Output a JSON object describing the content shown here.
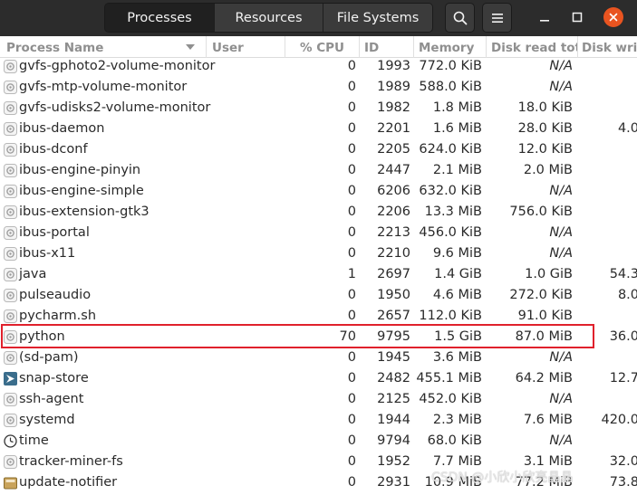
{
  "header": {
    "tabs": [
      {
        "label": "Processes",
        "active": true
      },
      {
        "label": "Resources",
        "active": false
      },
      {
        "label": "File Systems",
        "active": false
      }
    ],
    "search_icon": "search-icon",
    "menu_icon": "hamburger-menu-icon",
    "window_controls": [
      "minimize-icon",
      "maximize-icon",
      "close-icon"
    ],
    "close_color": "#e95420"
  },
  "columns": {
    "name": "Process Name",
    "user": "User",
    "cpu": "% CPU",
    "id": "ID",
    "memory": "Memory",
    "disk_read": "Disk read tota",
    "disk_write": "Disk writ"
  },
  "rows": [
    {
      "name": "gvfs-gphoto2-volume-monitor",
      "cpu": "0",
      "id": "1993",
      "memory": "772.0 KiB",
      "disk_read": "N/A",
      "disk_write": "",
      "icon": "gear-icon"
    },
    {
      "name": "gvfs-mtp-volume-monitor",
      "cpu": "0",
      "id": "1989",
      "memory": "588.0 KiB",
      "disk_read": "N/A",
      "disk_write": "",
      "icon": "gear-icon"
    },
    {
      "name": "gvfs-udisks2-volume-monitor",
      "cpu": "0",
      "id": "1982",
      "memory": "1.8 MiB",
      "disk_read": "18.0 KiB",
      "disk_write": "",
      "icon": "gear-icon"
    },
    {
      "name": "ibus-daemon",
      "cpu": "0",
      "id": "2201",
      "memory": "1.6 MiB",
      "disk_read": "28.0 KiB",
      "disk_write": "4.0",
      "icon": "gear-icon"
    },
    {
      "name": "ibus-dconf",
      "cpu": "0",
      "id": "2205",
      "memory": "624.0 KiB",
      "disk_read": "12.0 KiB",
      "disk_write": "",
      "icon": "gear-icon"
    },
    {
      "name": "ibus-engine-pinyin",
      "cpu": "0",
      "id": "2447",
      "memory": "2.1 MiB",
      "disk_read": "2.0 MiB",
      "disk_write": "",
      "icon": "gear-icon"
    },
    {
      "name": "ibus-engine-simple",
      "cpu": "0",
      "id": "6206",
      "memory": "632.0 KiB",
      "disk_read": "N/A",
      "disk_write": "",
      "icon": "gear-icon"
    },
    {
      "name": "ibus-extension-gtk3",
      "cpu": "0",
      "id": "2206",
      "memory": "13.3 MiB",
      "disk_read": "756.0 KiB",
      "disk_write": "",
      "icon": "gear-icon"
    },
    {
      "name": "ibus-portal",
      "cpu": "0",
      "id": "2213",
      "memory": "456.0 KiB",
      "disk_read": "N/A",
      "disk_write": "",
      "icon": "gear-icon"
    },
    {
      "name": "ibus-x11",
      "cpu": "0",
      "id": "2210",
      "memory": "9.6 MiB",
      "disk_read": "N/A",
      "disk_write": "",
      "icon": "gear-icon"
    },
    {
      "name": "java",
      "cpu": "1",
      "id": "2697",
      "memory": "1.4 GiB",
      "disk_read": "1.0 GiB",
      "disk_write": "54.3",
      "icon": "gear-icon"
    },
    {
      "name": "pulseaudio",
      "cpu": "0",
      "id": "1950",
      "memory": "4.6 MiB",
      "disk_read": "272.0 KiB",
      "disk_write": "8.0",
      "icon": "gear-icon"
    },
    {
      "name": "pycharm.sh",
      "cpu": "0",
      "id": "2657",
      "memory": "112.0 KiB",
      "disk_read": "91.0 KiB",
      "disk_write": "",
      "icon": "gear-icon"
    },
    {
      "name": "python",
      "cpu": "70",
      "id": "9795",
      "memory": "1.5 GiB",
      "disk_read": "87.0 MiB",
      "disk_write": "36.0",
      "icon": "gear-icon",
      "highlighted": true
    },
    {
      "name": "(sd-pam)",
      "cpu": "0",
      "id": "1945",
      "memory": "3.6 MiB",
      "disk_read": "N/A",
      "disk_write": "",
      "icon": "gear-icon"
    },
    {
      "name": "snap-store",
      "cpu": "0",
      "id": "2482",
      "memory": "455.1 MiB",
      "disk_read": "64.2 MiB",
      "disk_write": "12.7",
      "icon": "snap-store-icon"
    },
    {
      "name": "ssh-agent",
      "cpu": "0",
      "id": "2125",
      "memory": "452.0 KiB",
      "disk_read": "N/A",
      "disk_write": "",
      "icon": "gear-icon"
    },
    {
      "name": "systemd",
      "cpu": "0",
      "id": "1944",
      "memory": "2.3 MiB",
      "disk_read": "7.6 MiB",
      "disk_write": "420.0",
      "icon": "gear-icon"
    },
    {
      "name": "time",
      "cpu": "0",
      "id": "9794",
      "memory": "68.0 KiB",
      "disk_read": "N/A",
      "disk_write": "",
      "icon": "clock-icon"
    },
    {
      "name": "tracker-miner-fs",
      "cpu": "0",
      "id": "1952",
      "memory": "7.7 MiB",
      "disk_read": "3.1 MiB",
      "disk_write": "32.0",
      "icon": "gear-icon"
    },
    {
      "name": "update-notifier",
      "cpu": "0",
      "id": "2931",
      "memory": "10.9 MiB",
      "disk_read": "77.2 MiB",
      "disk_write": "73.8",
      "icon": "update-notifier-icon"
    }
  ],
  "highlight_color": "#e0212c",
  "watermark": "CSDN @小欣小欣亮晶晶"
}
